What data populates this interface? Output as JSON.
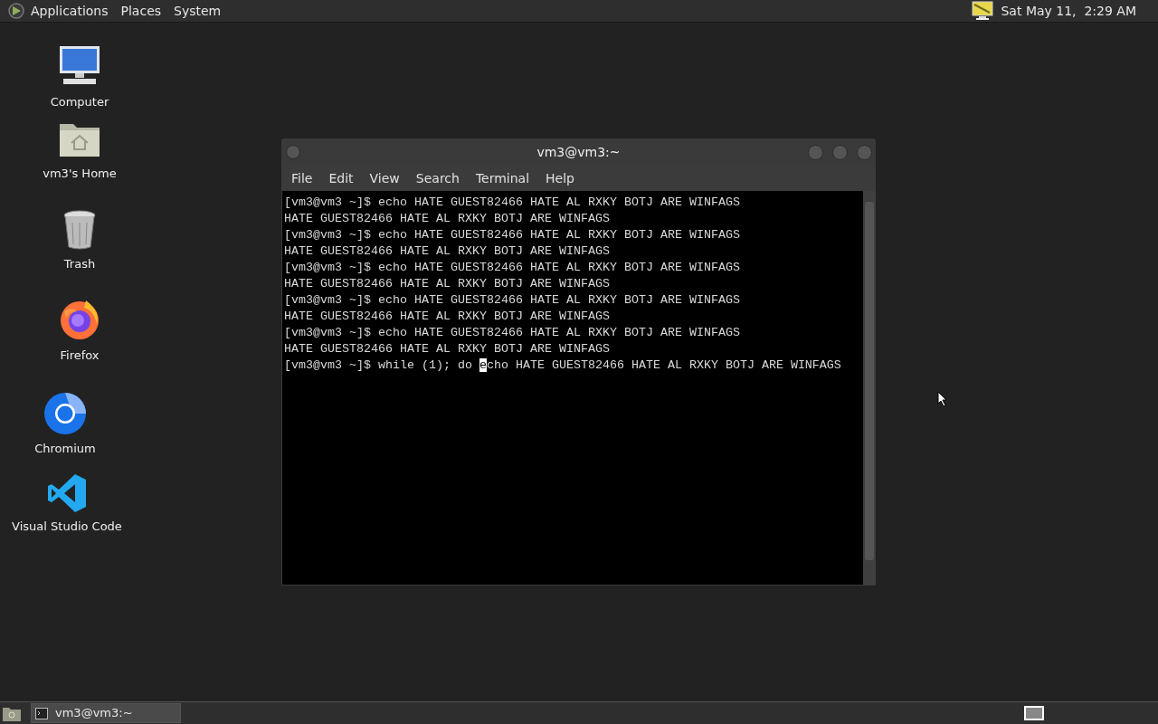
{
  "top_panel": {
    "menus": [
      "Applications",
      "Places",
      "System"
    ],
    "clock": "Sat May 11,  2:29 AM"
  },
  "desktop_icons": [
    {
      "label": "Computer",
      "kind": "computer"
    },
    {
      "label": "vm3's Home",
      "kind": "home"
    },
    {
      "label": "Trash",
      "kind": "trash"
    },
    {
      "label": "Firefox",
      "kind": "firefox"
    },
    {
      "label": "Chromium",
      "kind": "chromium"
    },
    {
      "label": "Visual Studio Code",
      "kind": "vscode"
    }
  ],
  "terminal": {
    "title": "vm3@vm3:~",
    "menu": [
      "File",
      "Edit",
      "View",
      "Search",
      "Terminal",
      "Help"
    ],
    "lines": [
      "[vm3@vm3 ~]$ echo HATE GUEST82466 HATE AL RXKY BOTJ ARE WINFAGS",
      "HATE GUEST82466 HATE AL RXKY BOTJ ARE WINFAGS",
      "[vm3@vm3 ~]$ echo HATE GUEST82466 HATE AL RXKY BOTJ ARE WINFAGS",
      "HATE GUEST82466 HATE AL RXKY BOTJ ARE WINFAGS",
      "[vm3@vm3 ~]$ echo HATE GUEST82466 HATE AL RXKY BOTJ ARE WINFAGS",
      "HATE GUEST82466 HATE AL RXKY BOTJ ARE WINFAGS",
      "[vm3@vm3 ~]$ echo HATE GUEST82466 HATE AL RXKY BOTJ ARE WINFAGS",
      "HATE GUEST82466 HATE AL RXKY BOTJ ARE WINFAGS",
      "[vm3@vm3 ~]$ echo HATE GUEST82466 HATE AL RXKY BOTJ ARE WINFAGS",
      "HATE GUEST82466 HATE AL RXKY BOTJ ARE WINFAGS"
    ],
    "input_line": {
      "before_cursor": "[vm3@vm3 ~]$ while (1); do ",
      "at_cursor": "e",
      "after_cursor": "cho HATE GUEST82466 HATE AL RXKY BOTJ ARE WINFAGS"
    }
  },
  "taskbar": {
    "windows": [
      {
        "label": "vm3@vm3:~",
        "selected": true
      }
    ]
  }
}
